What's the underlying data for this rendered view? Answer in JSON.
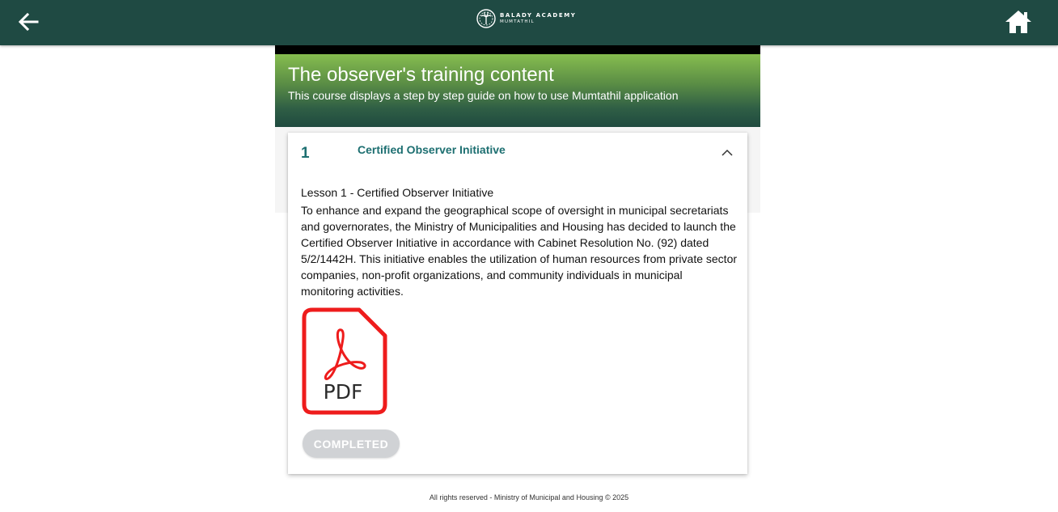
{
  "header": {
    "brand_line1": "BALADY ACADEMY",
    "brand_line2": "MUMTATHIL",
    "back_icon": "arrow-left-icon",
    "home_icon": "home-icon",
    "bar_color": "#1f4a43"
  },
  "course": {
    "title": "The observer's training content",
    "subtitle": "This course displays a step by step guide on how to use Mumtathil application"
  },
  "section": {
    "number": "1",
    "title": "Certified Observer Initiative",
    "expanded": true,
    "lesson_title": "Lesson 1 - Certified Observer Initiative",
    "lesson_body": "To enhance and expand the geographical scope of oversight in municipal secretariats and governorates, the Ministry of Municipalities and Housing has decided to launch the Certified Observer Initiative in accordance with Cabinet Resolution No. (92) dated 5/2/1442H. This initiative enables the utilization of human resources from private sector companies, non-profit organizations, and community individuals in municipal monitoring activities.",
    "attachment_label": "PDF",
    "status_button": "COMPLETED",
    "accent_color": "#1d6f71"
  },
  "footer": {
    "text": "All rights reserved - Ministry of Municipal and Housing © 2025"
  }
}
